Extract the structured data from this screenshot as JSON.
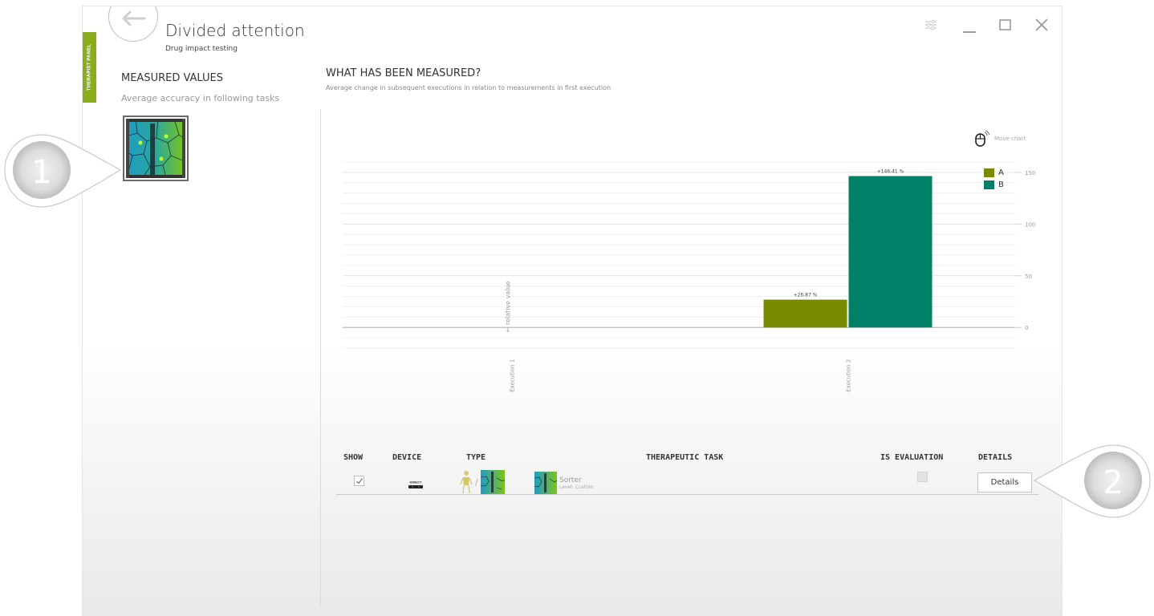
{
  "window": {
    "title": "Divided attention",
    "subtitle": "Drug impact testing",
    "side_tab": "THERAPIST PANEL"
  },
  "sidebar": {
    "heading": "MEASURED VALUES",
    "subheading": "Average accuracy in following tasks"
  },
  "main": {
    "heading": "WHAT HAS BEEN MEASURED?",
    "subheading": "Average change in subsequent executions in relation to measurements in first execution",
    "move_chart_label": "Move chart"
  },
  "chart_data": {
    "type": "bar",
    "categories": [
      "Execution 1",
      "Execution 2"
    ],
    "series": [
      {
        "name": "A",
        "values": [
          0,
          26.87
        ],
        "labels": [
          "",
          "+26.87 %"
        ],
        "color": "#7a8a00"
      },
      {
        "name": "B",
        "values": [
          0,
          146.41
        ],
        "labels": [
          "",
          "+146.41 %"
        ],
        "color": "#008066"
      }
    ],
    "ylabel": "← relative value",
    "yticks": [
      0,
      50,
      100,
      150
    ],
    "ylim": [
      -20,
      160
    ],
    "grid": true,
    "legend": "top-right"
  },
  "table": {
    "headers": {
      "show": "SHOW",
      "device": "DEVICE",
      "type": "TYPE",
      "task": "THERAPEUTIC TASK",
      "evaluation": "IS EVALUATION",
      "details": "DETAILS"
    },
    "rows": [
      {
        "show": true,
        "device_label": "KINECT",
        "separator": "/",
        "task_name": "Sorter",
        "task_level": "Level: Custom",
        "is_evaluation": false,
        "details_label": "Details"
      }
    ]
  },
  "callouts": [
    "1",
    "2"
  ],
  "colors": {
    "accent_green": "#8aae1b",
    "series_a": "#7a8a00",
    "series_b": "#008066"
  }
}
